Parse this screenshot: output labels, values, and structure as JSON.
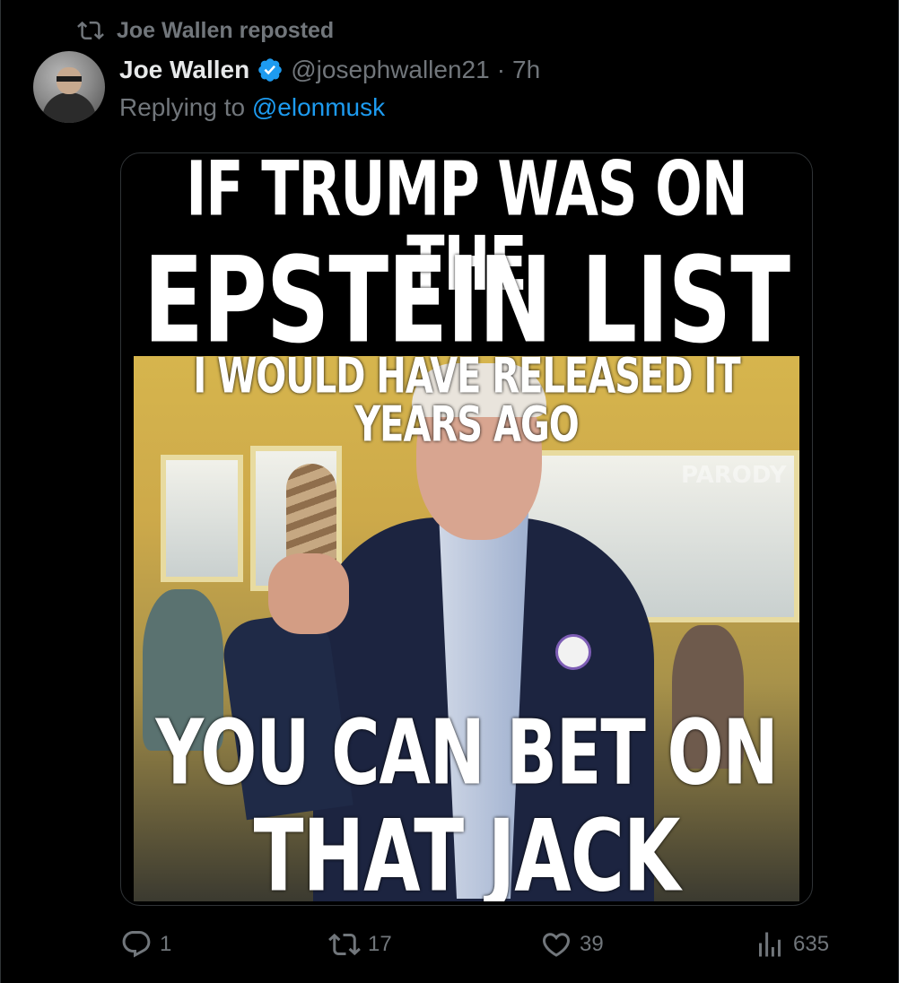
{
  "repost": {
    "text": "Joe Wallen reposted"
  },
  "tweet": {
    "display_name": "Joe Wallen",
    "handle": "@josephwallen21",
    "separator": "·",
    "time": "7h",
    "replying_prefix": "Replying to",
    "replying_to": "@elonmusk",
    "verified": true
  },
  "meme": {
    "line1": "IF TRUMP WAS ON THE",
    "line2": "EPSTEIN LIST",
    "line3": "I WOULD HAVE RELEASED IT YEARS AGO",
    "line4": "YOU CAN BET ON",
    "line5": "THAT JACK",
    "watermark": "PARODY"
  },
  "actions": {
    "replies": "1",
    "reposts": "17",
    "likes": "39",
    "views": "635"
  },
  "colors": {
    "background": "#000000",
    "text": "#e7e9ea",
    "muted": "#71767b",
    "accent": "#1d9bf0"
  },
  "icons": {
    "repost": "repost-icon",
    "verified": "verified-badge-icon",
    "reply": "reply-icon",
    "like": "heart-icon",
    "views": "views-chart-icon"
  }
}
